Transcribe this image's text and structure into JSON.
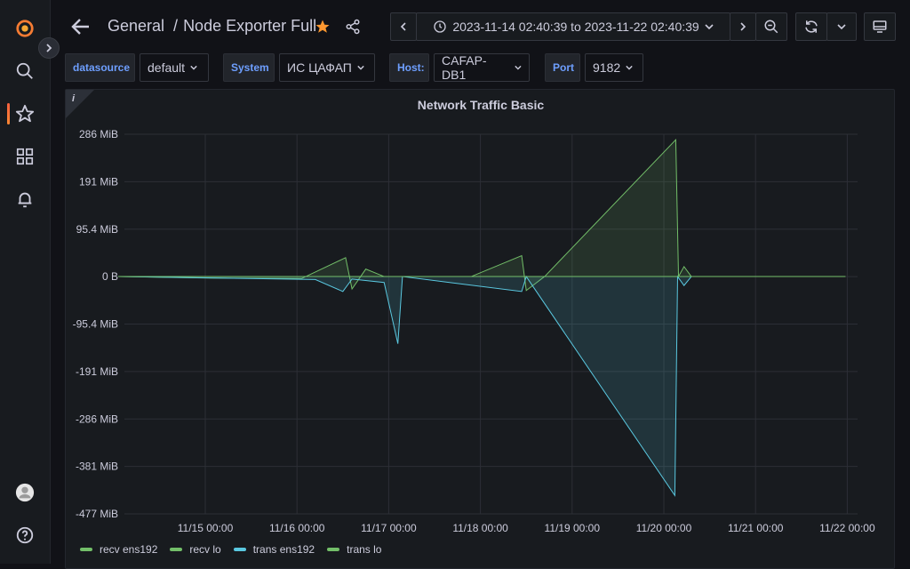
{
  "sidebar": {
    "items": [
      {
        "icon": "grafana-logo-icon"
      },
      {
        "icon": "search-icon"
      },
      {
        "icon": "star-icon",
        "active": true
      },
      {
        "icon": "apps-grid-icon"
      },
      {
        "icon": "bell-icon"
      },
      {
        "icon": "user-avatar-icon"
      },
      {
        "icon": "help-icon"
      }
    ]
  },
  "header": {
    "folder": "General",
    "separator": "/",
    "dashboard": "Node Exporter Full",
    "time_range": "2023-11-14 02:40:39 to 2023-11-22 02:40:39"
  },
  "variables": [
    {
      "label": "datasource",
      "value": "default"
    },
    {
      "label": "System",
      "value": "ИС ЦАФАП"
    },
    {
      "label": "Host:",
      "value": "CAFAP-DB1"
    },
    {
      "label": "Port",
      "value": "9182"
    }
  ],
  "panel": {
    "title": "Network Traffic Basic"
  },
  "colors": {
    "recv": "#73bf69",
    "trans": "#5ac8e0",
    "accent": "#ff9830",
    "var_label": "#6e9fff"
  },
  "chart_data": {
    "type": "line",
    "title": "Network Traffic Basic",
    "y_ticks": [
      "286 MiB",
      "191 MiB",
      "95.4 MiB",
      "0 B",
      "-95.4 MiB",
      "-191 MiB",
      "-286 MiB",
      "-381 MiB",
      "-477 MiB"
    ],
    "ylim": [
      -477,
      286
    ],
    "y_unit": "MiB",
    "x_ticks": [
      "11/15 00:00",
      "11/16 00:00",
      "11/17 00:00",
      "11/18 00:00",
      "11/19 00:00",
      "11/20 00:00",
      "11/21 00:00",
      "11/22 00:00"
    ],
    "x_range_days": [
      0,
      8
    ],
    "grid": true,
    "legend_position": "bottom",
    "series": [
      {
        "name": "recv ens192",
        "color": "#73bf69",
        "points": [
          [
            0.05,
            0
          ],
          [
            1.05,
            -3
          ],
          [
            2.05,
            -4
          ],
          [
            2.53,
            38
          ],
          [
            2.6,
            -25
          ],
          [
            2.75,
            15
          ],
          [
            2.95,
            0
          ],
          [
            3.9,
            0
          ],
          [
            4.45,
            42
          ],
          [
            4.5,
            -28
          ],
          [
            4.7,
            0
          ],
          [
            6.13,
            275
          ],
          [
            6.16,
            0
          ],
          [
            6.22,
            20
          ],
          [
            6.3,
            0
          ]
        ]
      },
      {
        "name": "recv lo",
        "color": "#73bf69",
        "points": [
          [
            0.05,
            0
          ],
          [
            7.98,
            0
          ]
        ]
      },
      {
        "name": "trans ens192",
        "color": "#5ac8e0",
        "points": [
          [
            0.05,
            0
          ],
          [
            2.2,
            -6
          ],
          [
            2.5,
            -30
          ],
          [
            2.6,
            -5
          ],
          [
            2.95,
            -12
          ],
          [
            3.1,
            -135
          ],
          [
            3.15,
            0
          ],
          [
            4.45,
            -30
          ],
          [
            4.5,
            0
          ],
          [
            6.12,
            -440
          ],
          [
            6.15,
            0
          ],
          [
            6.22,
            -18
          ],
          [
            6.3,
            0
          ]
        ]
      },
      {
        "name": "trans lo",
        "color": "#73bf69",
        "points": [
          [
            0.05,
            0
          ],
          [
            7.98,
            0
          ]
        ]
      }
    ]
  }
}
